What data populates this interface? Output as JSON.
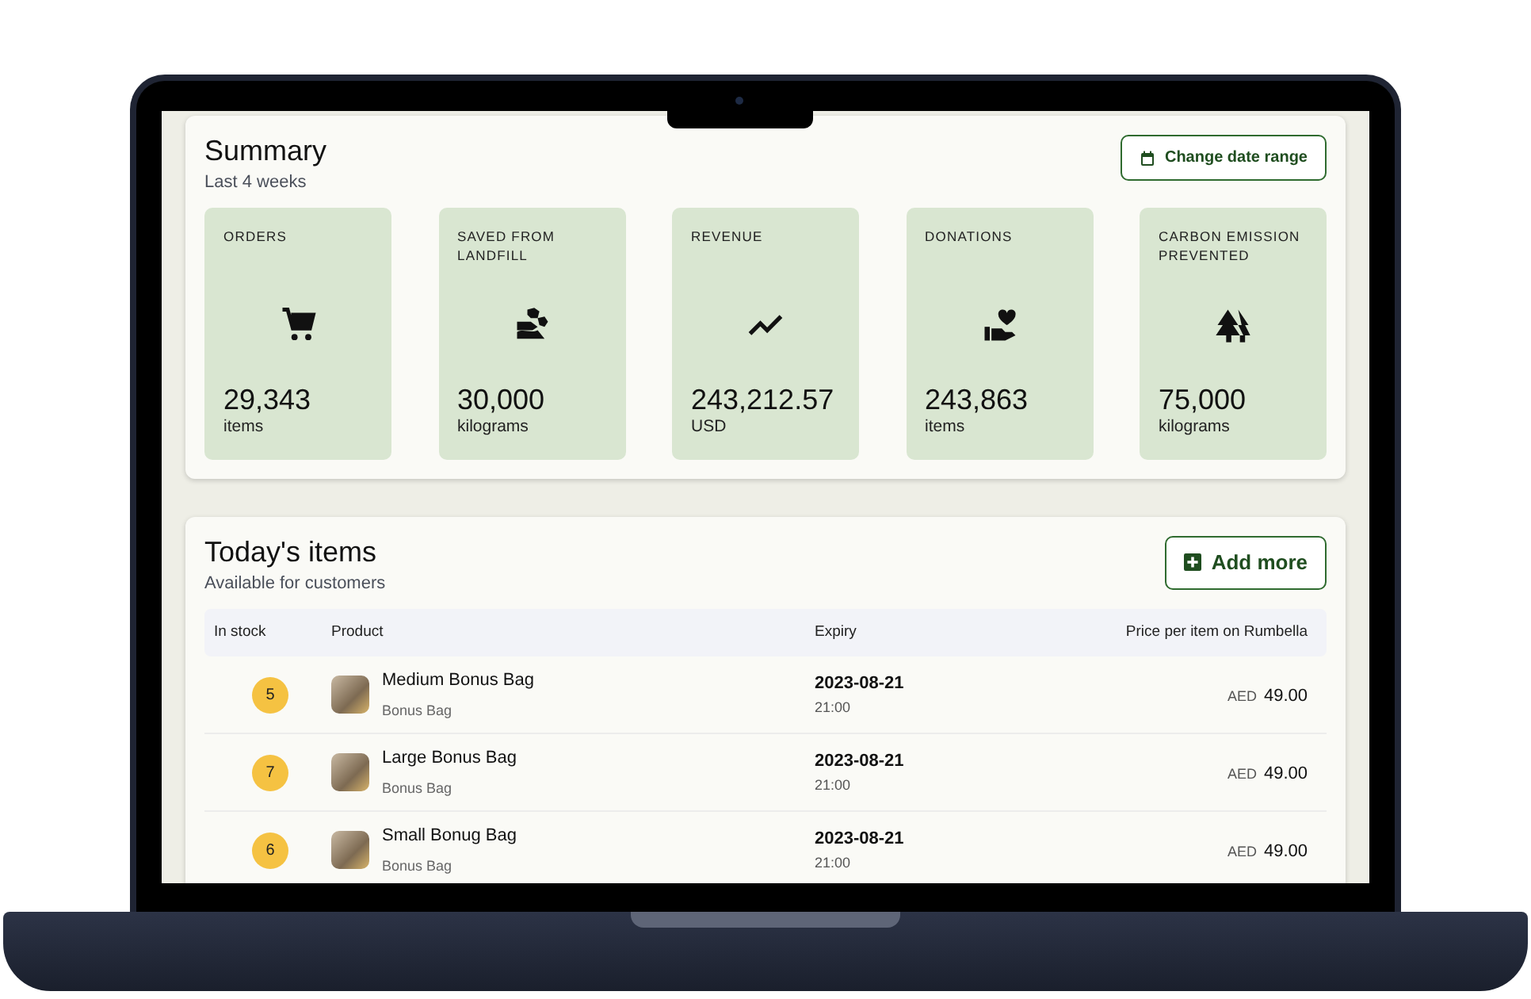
{
  "summary": {
    "title": "Summary",
    "subtitle": "Last 4 weeks",
    "button": "Change date range",
    "stats": [
      {
        "kind": "cart",
        "label": "ORDERS",
        "value": "29,343",
        "unit": "items"
      },
      {
        "kind": "landfill",
        "label": "SAVED FROM LANDFILL",
        "value": "30,000",
        "unit": "kilograms"
      },
      {
        "kind": "trend",
        "label": "REVENUE",
        "value": "243,212.57",
        "unit": "USD"
      },
      {
        "kind": "donation",
        "label": "DONATIONS",
        "value": "243,863",
        "unit": "items"
      },
      {
        "kind": "trees",
        "label": "CARBON EMISSION PREVENTED",
        "value": "75,000",
        "unit": "kilograms"
      }
    ]
  },
  "items": {
    "title": "Today's items",
    "subtitle": "Available for customers",
    "button": "Add more",
    "columns": [
      "In stock",
      "Product",
      "Expiry",
      "Price per item on Rumbella"
    ],
    "rows": [
      {
        "stock": "5",
        "name": "Medium Bonus Bag",
        "category": "Bonus Bag",
        "date": "2023-08-21",
        "time": "21:00",
        "currency": "AED",
        "price": "49.00"
      },
      {
        "stock": "7",
        "name": "Large Bonus Bag",
        "category": "Bonus Bag",
        "date": "2023-08-21",
        "time": "21:00",
        "currency": "AED",
        "price": "49.00"
      },
      {
        "stock": "6",
        "name": "Small Bonug Bag",
        "category": "Bonus Bag",
        "date": "2023-08-21",
        "time": "21:00",
        "currency": "AED",
        "price": "49.00"
      }
    ]
  }
}
